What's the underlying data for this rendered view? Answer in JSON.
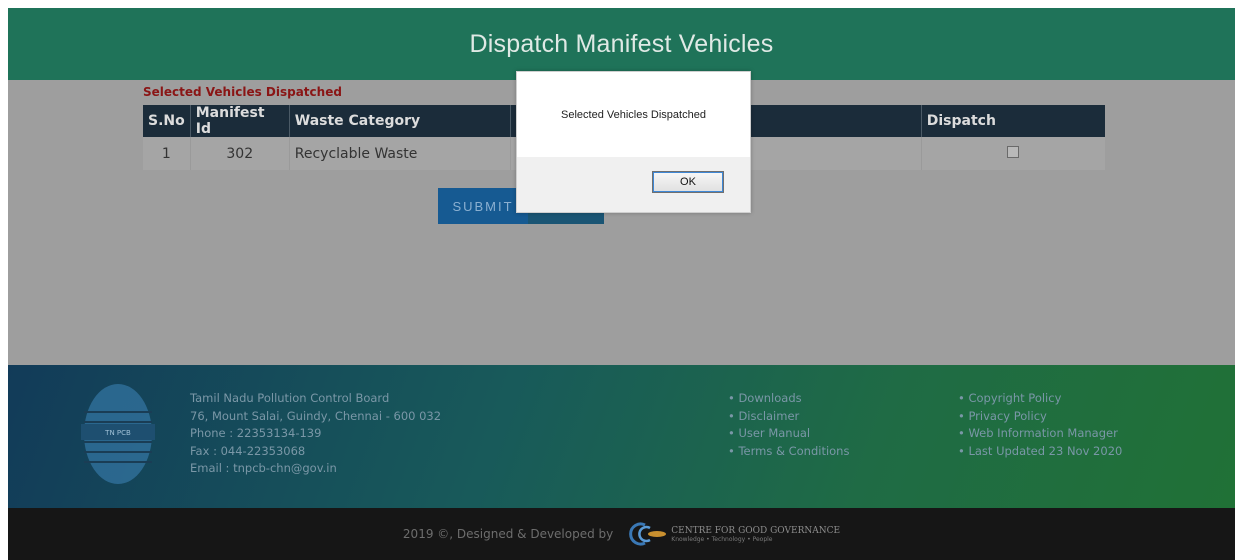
{
  "header": {
    "title": "Dispatch Manifest Vehicles"
  },
  "status_message": "Selected Vehicles Dispatched",
  "table": {
    "columns": [
      "S.No",
      "Manifest Id",
      "Waste Category",
      "",
      "Dispatch"
    ],
    "rows": [
      {
        "sno": "1",
        "manifest_id": "302",
        "waste_category": "Recyclable Waste",
        "extra": "",
        "dispatch_checked": false
      }
    ]
  },
  "buttons": {
    "submit": "SUBMIT",
    "back": "BACK"
  },
  "footer": {
    "org": [
      "Tamil Nadu Pollution Control Board",
      "76, Mount Salai, Guindy, Chennai - 600 032",
      "Phone : 22353134-139",
      "Fax : 044-22353068",
      "Email : tnpcb-chn@gov.in"
    ],
    "links_col1": [
      "Downloads",
      "Disclaimer",
      "User Manual",
      "Terms & Conditions"
    ],
    "links_col2": [
      "Copyright Policy",
      "Privacy Policy",
      "Web Information Manager",
      "Last Updated 23 Nov 2020"
    ],
    "logo_text": "TN PCB"
  },
  "bottom_bar": {
    "credit": "2019 ©, Designed & Developed by",
    "cgg_name": "CENTRE FOR GOOD GOVERNANCE",
    "cgg_tagline": "Knowledge • Technology • People"
  },
  "dialog": {
    "message": "Selected Vehicles Dispatched",
    "ok_label": "OK"
  },
  "colors": {
    "header": "#1f7359",
    "table_header": "#1b2c3a",
    "submit": "#165a92",
    "message": "#8a1515"
  }
}
